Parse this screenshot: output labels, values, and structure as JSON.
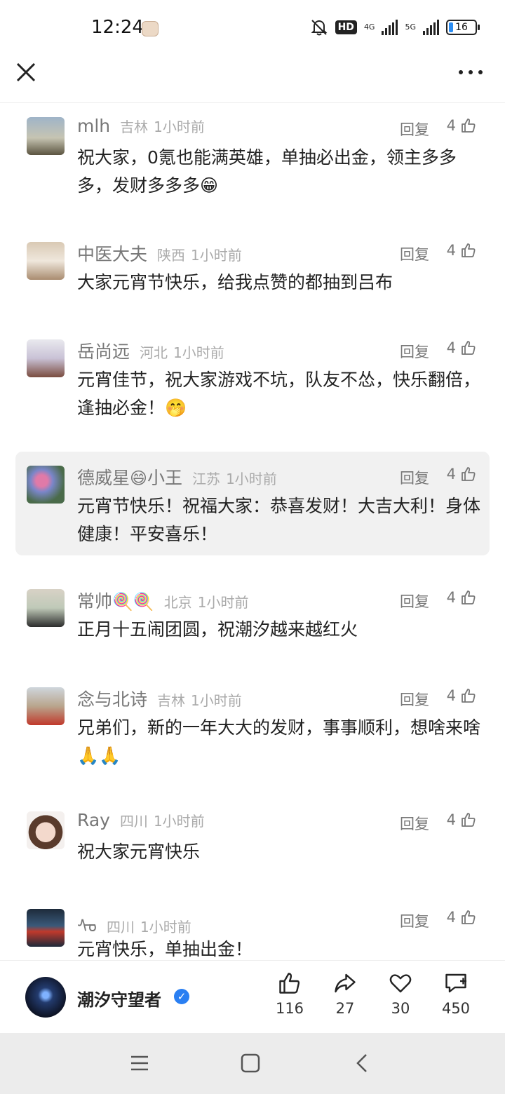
{
  "status_bar": {
    "time": "12:24",
    "network_hd": "HD",
    "net1": "4G",
    "net2": "5G",
    "battery": "16"
  },
  "comments": [
    {
      "user": "mlh",
      "emoji": "",
      "user_suffix": "",
      "location": "吉林",
      "time": "1小时前",
      "reply": "回复",
      "likes": "4",
      "text": "祝大家，0氪也能满英雄，单抽必出金，领主多多多，发财多多多😁"
    },
    {
      "user": "中医大夫",
      "emoji": "",
      "user_suffix": "",
      "location": "陕西",
      "time": "1小时前",
      "reply": "回复",
      "likes": "4",
      "text": "大家元宵节快乐，给我点赞的都抽到吕布"
    },
    {
      "user": "岳尚远",
      "emoji": "",
      "user_suffix": "",
      "location": "河北",
      "time": "1小时前",
      "reply": "回复",
      "likes": "4",
      "text": "元宵佳节，祝大家游戏不坑，队友不怂，快乐翻倍，逢抽必金！🤭"
    },
    {
      "user": "德威星",
      "emoji": "😄",
      "user_suffix": "小王",
      "location": "江苏",
      "time": "1小时前",
      "reply": "回复",
      "likes": "4",
      "text": "元宵节快乐！祝福大家：恭喜发财！大吉大利！身体健康！平安喜乐！"
    },
    {
      "user": "常帅",
      "emoji": "🍭🍭",
      "user_suffix": "",
      "location": "北京",
      "time": "1小时前",
      "reply": "回复",
      "likes": "4",
      "text": "正月十五闹团圆，祝潮汐越来越红火"
    },
    {
      "user": "念与北诗",
      "emoji": "",
      "user_suffix": "",
      "location": "吉林",
      "time": "1小时前",
      "reply": "回复",
      "likes": "4",
      "text": "兄弟们，新的一年大大的发财，事事顺利，想啥来啥🙏🙏"
    },
    {
      "user": "Ray",
      "emoji": "",
      "user_suffix": "",
      "location": "四川",
      "time": "1小时前",
      "reply": "回复",
      "likes": "4",
      "text": "祝大家元宵快乐"
    },
    {
      "user": "ᠰᠣ",
      "emoji": "",
      "user_suffix": "",
      "location": "四川",
      "time": "1小时前",
      "reply": "回复",
      "likes": "4",
      "text": "元宵快乐，单抽出金！"
    }
  ],
  "account": {
    "name": "潮汐守望者"
  },
  "actions": {
    "like": "116",
    "share": "27",
    "favorite": "30",
    "comment": "450"
  },
  "colors": {
    "verified": "#2a7ff2",
    "highlight_bg": "#f1f1f1"
  }
}
